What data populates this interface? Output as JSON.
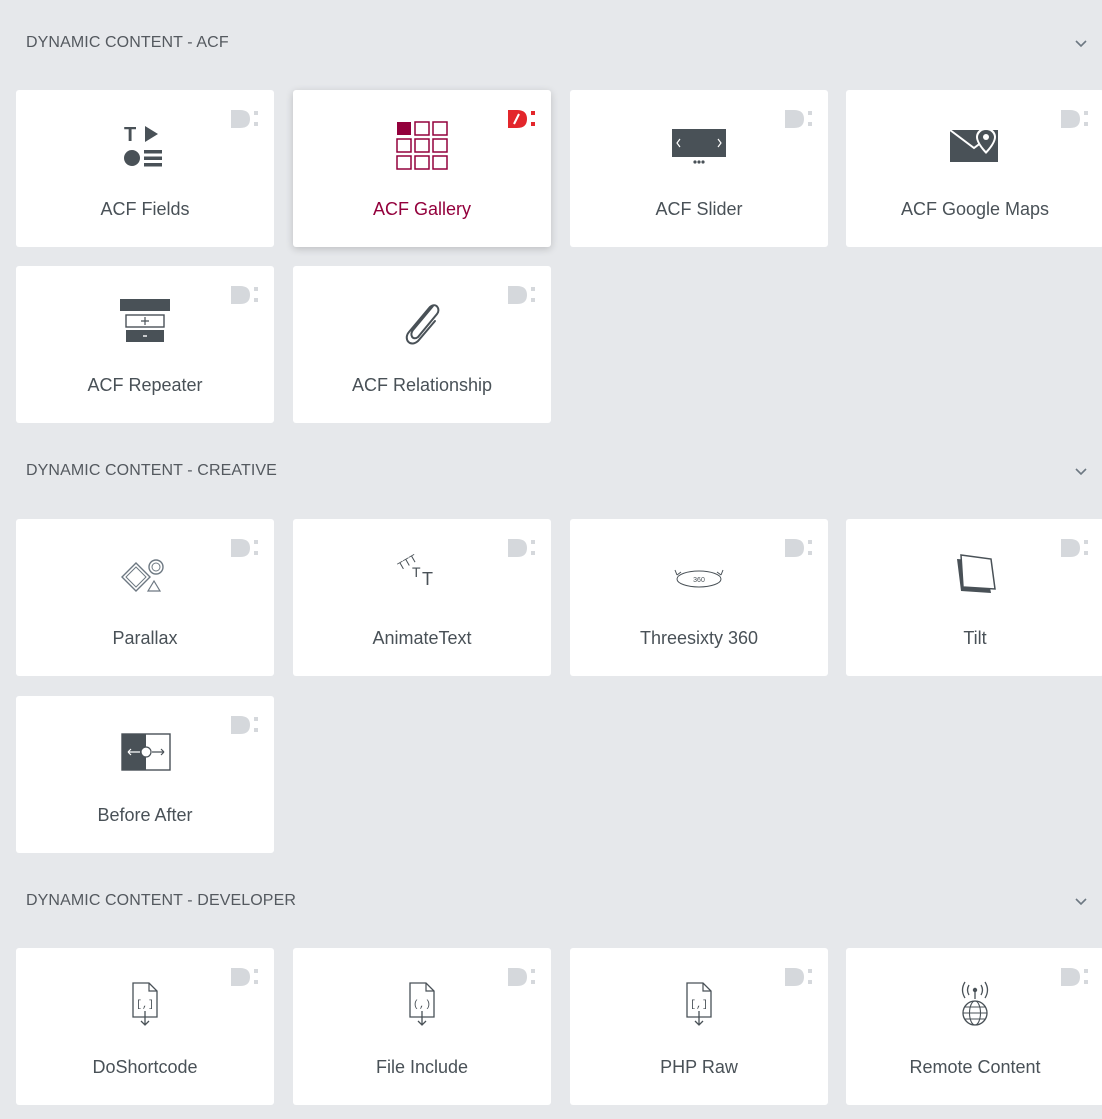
{
  "colors": {
    "background": "#e6e8eb",
    "card": "#ffffff",
    "text": "#495157",
    "header_text": "#54595f",
    "accent": "#93003c",
    "badge_inactive": "#d5d8dc",
    "badge_active": "#e3262b",
    "icon_dark": "#495157"
  },
  "sections": [
    {
      "title": "DYNAMIC CONTENT - ACF",
      "widgets": [
        {
          "label": "ACF Fields",
          "icon": "acf-fields-icon"
        },
        {
          "label": "ACF Gallery",
          "icon": "acf-gallery-icon"
        },
        {
          "label": "ACF Slider",
          "icon": "acf-slider-icon"
        },
        {
          "label": "ACF Google Maps",
          "icon": "acf-google-maps-icon"
        },
        {
          "label": "ACF Repeater",
          "icon": "acf-repeater-icon"
        },
        {
          "label": "ACF Relationship",
          "icon": "paperclip-icon"
        }
      ]
    },
    {
      "title": "DYNAMIC CONTENT - CREATIVE",
      "widgets": [
        {
          "label": "Parallax",
          "icon": "parallax-icon"
        },
        {
          "label": "AnimateText",
          "icon": "animate-text-icon",
          "icon_text": "TTT"
        },
        {
          "label": "Threesixty 360",
          "icon": "threesixty-icon",
          "icon_text": "360"
        },
        {
          "label": "Tilt",
          "icon": "tilt-icon"
        },
        {
          "label": "Before After",
          "icon": "before-after-icon"
        }
      ]
    },
    {
      "title": "DYNAMIC CONTENT - DEVELOPER",
      "widgets": [
        {
          "label": "DoShortcode",
          "icon": "doshortcode-icon"
        },
        {
          "label": "File Include",
          "icon": "file-include-icon"
        },
        {
          "label": "PHP Raw",
          "icon": "php-raw-icon"
        },
        {
          "label": "Remote Content",
          "icon": "remote-content-icon"
        }
      ]
    }
  ]
}
